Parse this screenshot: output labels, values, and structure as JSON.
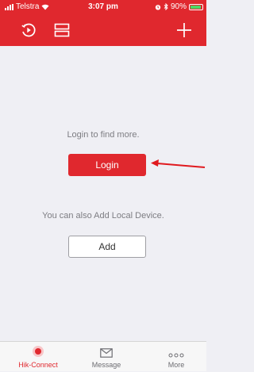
{
  "status_bar": {
    "carrier": "Telstra",
    "time": "3:07 pm",
    "battery": "90%"
  },
  "header": {
    "icons": [
      "history-icon",
      "layout-icon",
      "add-icon"
    ]
  },
  "main": {
    "login_prompt": "Login to find more.",
    "login_button": "Login",
    "local_prompt": "You can also Add Local Device.",
    "add_button": "Add"
  },
  "tabs": [
    {
      "label": "Hik-Connect",
      "icon": "hik-connect-icon",
      "active": true
    },
    {
      "label": "Message",
      "icon": "envelope-icon",
      "active": false
    },
    {
      "label": "More",
      "icon": "ellipsis-icon",
      "active": false
    }
  ],
  "colors": {
    "brand": "#e0282e",
    "background": "#efeff4",
    "annotation_arrow": "#e0191e"
  }
}
